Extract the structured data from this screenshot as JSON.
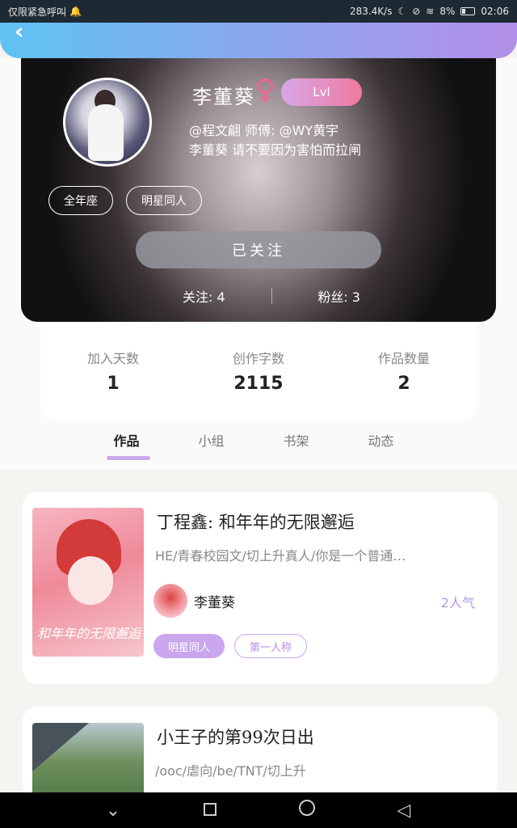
{
  "status_bar": {
    "left_text": "仅限紧急呼叫",
    "speed": "283.4K/s",
    "battery": "8%",
    "time": "02:06"
  },
  "profile": {
    "name": "李董葵",
    "gender_symbol": "♀",
    "level": "Lvl",
    "bio_line1": "@程文翩 师傅: @WY黄宇",
    "bio_line2": "李董葵 请不要因为害怕而拉闸",
    "tags": [
      "全年座",
      "明星同人"
    ],
    "follow_button": "已关注",
    "following_label": "关注: 4",
    "followers_label": "粉丝: 3"
  },
  "stats": [
    {
      "label": "加入天数",
      "value": "1"
    },
    {
      "label": "创作字数",
      "value": "2115"
    },
    {
      "label": "作品数量",
      "value": "2"
    }
  ],
  "tabs": [
    "作品",
    "小组",
    "书架",
    "动态"
  ],
  "works": [
    {
      "title": "丁程鑫: 和年年的无限邂逅",
      "desc": "HE/青春校园文/切上升真人/你是一个普通…",
      "author": "李董葵",
      "readers": "2人气",
      "cover_text": "和年年的无限邂逅",
      "tags": [
        "明星同人",
        "第一人称"
      ]
    },
    {
      "title": "小王子的第99次日出",
      "desc": "/ooc/虐向/be/TNT/切上升"
    }
  ]
}
